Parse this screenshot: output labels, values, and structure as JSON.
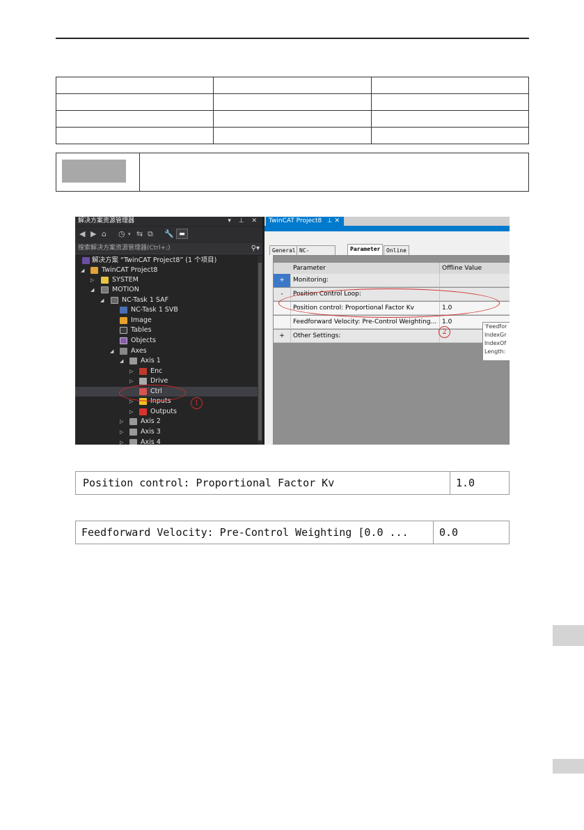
{
  "screenshot": {
    "solution_explorer": {
      "title": "解决方案资源管理器",
      "title_controls": "▾ ⊥ ✕",
      "search_placeholder": "搜索解决方案资源管理器(Ctrl+;)",
      "tree": [
        {
          "label": "解决方案 “TwinCAT Project8” (1 个项目)",
          "icon": "solution-icon"
        },
        {
          "label": "TwinCAT Project8",
          "icon": "project-icon"
        },
        {
          "label": "SYSTEM",
          "icon": "system-icon"
        },
        {
          "label": "MOTION",
          "icon": "motion-icon"
        },
        {
          "label": "NC-Task 1 SAF",
          "icon": "task-icon"
        },
        {
          "label": "NC-Task 1 SVB",
          "icon": "svb-icon"
        },
        {
          "label": "Image",
          "icon": "image-icon"
        },
        {
          "label": "Tables",
          "icon": "tables-icon"
        },
        {
          "label": "Objects",
          "icon": "objects-icon"
        },
        {
          "label": "Axes",
          "icon": "axes-icon"
        },
        {
          "label": "Axis 1",
          "icon": "axis-icon"
        },
        {
          "label": "Enc",
          "icon": "enc-icon"
        },
        {
          "label": "Drive",
          "icon": "drive-icon"
        },
        {
          "label": "Ctrl",
          "icon": "ctrl-icon"
        },
        {
          "label": "Inputs",
          "icon": "inputs-icon"
        },
        {
          "label": "Outputs",
          "icon": "outputs-icon"
        },
        {
          "label": "Axis 2",
          "icon": "axis-icon"
        },
        {
          "label": "Axis 3",
          "icon": "axis-icon"
        },
        {
          "label": "Axis 4",
          "icon": "axis-icon"
        }
      ]
    },
    "editor": {
      "doc_tab": "TwinCAT Project8",
      "doc_tab_controls": "⊥ ✕",
      "tabs": [
        "General",
        "NC-Controller",
        "Parameter",
        "Online"
      ],
      "active_tab": "Parameter",
      "columns": [
        "Parameter",
        "Offline Value"
      ],
      "rows": [
        {
          "toggle": "+",
          "name": "Monitoring:",
          "value": ""
        },
        {
          "toggle": "-",
          "name": "Position Control Loop:",
          "value": ""
        },
        {
          "toggle": "",
          "name": "Position control: Proportional Factor Kv",
          "value": "1.0"
        },
        {
          "toggle": "",
          "name": "Feedforward Velocity: Pre-Control Weighting...",
          "value": "1.0"
        },
        {
          "toggle": "+",
          "name": "Other Settings:",
          "value": ""
        }
      ],
      "tooltip_lines": [
        "'Feedfor",
        "IndexGr",
        "IndexOf",
        "Length:"
      ]
    },
    "markers": [
      "1",
      "2"
    ]
  },
  "zoom_rows": [
    {
      "label": "Position control: Proportional Factor Kv",
      "value": "1.0"
    },
    {
      "label": "Feedforward Velocity: Pre-Control Weighting [0.0 ...",
      "value": "0.0"
    }
  ],
  "colors": {
    "accent": "#007acc",
    "marker": "#d12b2b"
  }
}
